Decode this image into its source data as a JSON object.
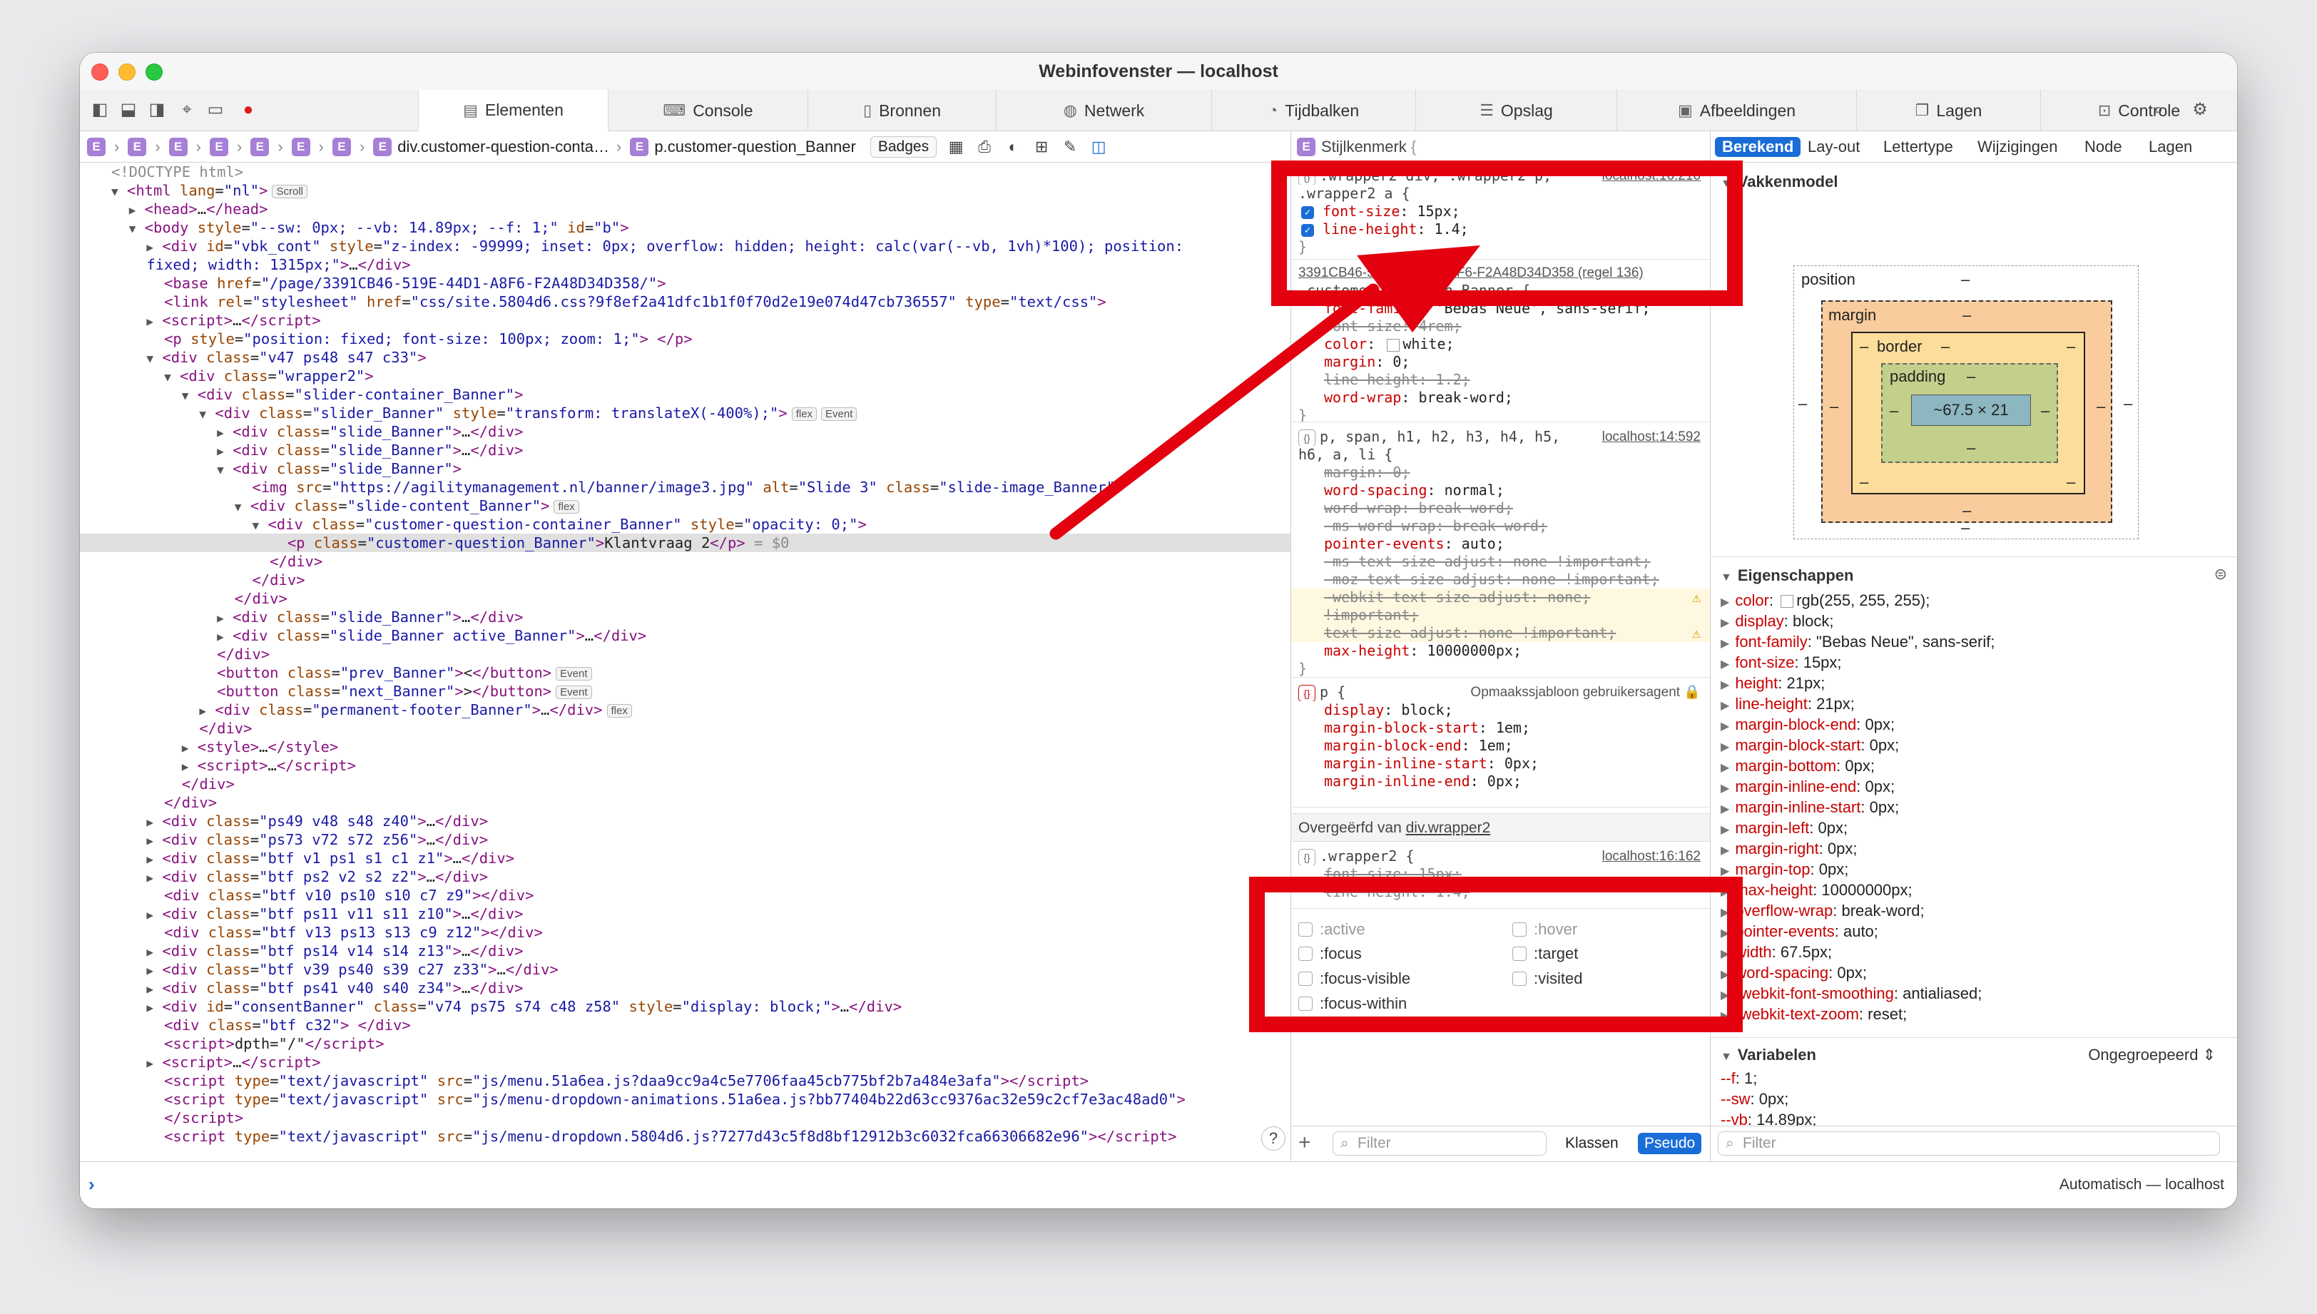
{
  "window": {
    "title": "Webinfovenster — localhost"
  },
  "tabs": [
    {
      "label": "Elementen",
      "icon": "elements-icon",
      "glyph": "▤"
    },
    {
      "label": "Console",
      "icon": "console-icon",
      "glyph": "⌨"
    },
    {
      "label": "Bronnen",
      "icon": "sources-icon",
      "glyph": "▯"
    },
    {
      "label": "Netwerk",
      "icon": "network-icon",
      "glyph": "◍"
    },
    {
      "label": "Tijdbalken",
      "icon": "timelines-icon",
      "glyph": "◔"
    },
    {
      "label": "Opslag",
      "icon": "storage-icon",
      "glyph": "☰"
    },
    {
      "label": "Afbeeldingen",
      "icon": "images-icon",
      "glyph": "▣"
    },
    {
      "label": "Lagen",
      "icon": "layers-icon",
      "glyph": "❐"
    },
    {
      "label": "Controle",
      "icon": "audit-icon",
      "glyph": "⊡"
    }
  ],
  "breadcrumb": {
    "generic_badge": "E",
    "item1": "div.customer-question-conta…",
    "item2": "p.customer-question_Banner",
    "badges_button": "Badges"
  },
  "dom": {
    "lines": [
      "&lt;!DOCTYPE html&gt;",
      "<span class='tri'>▼</span> <span class='tag'>&lt;html</span> <span class='an'>lang</span>=<span class='av'>\"nl\"</span><span class='tag'>&gt;</span><span class='pill'>Scroll</span>",
      "  <span class='tri'>▶</span> <span class='tag'>&lt;head&gt;</span>…<span class='tag'>&lt;/head&gt;</span>",
      "  <span class='tri'>▼</span> <span class='tag'>&lt;body</span> <span class='an'>style</span>=<span class='av'>\"--sw: 0px; --vb: 14.89px; --f: 1;\"</span> <span class='an'>id</span>=<span class='av'>\"b\"</span><span class='tag'>&gt;</span>",
      "    <span class='tri'>▶</span> <span class='tag'>&lt;div</span> <span class='an'>id</span>=<span class='av'>\"vbk_cont\"</span> <span class='an'>style</span>=<span class='av'>\"z-index: -99999; inset: 0px; overflow: hidden; height: calc(var(--vb, 1vh)*100); position:</span>",
      "    <span class='av'>fixed; width: 1315px;\"</span><span class='tag'>&gt;</span>…<span class='tag'>&lt;/div&gt;</span>",
      "      <span class='tag'>&lt;base</span> <span class='an'>href</span>=<span class='av'>\"/page/3391CB46-519E-44D1-A8F6-F2A48D34D358/\"</span><span class='tag'>&gt;</span>",
      "      <span class='tag'>&lt;link</span> <span class='an'>rel</span>=<span class='av'>\"stylesheet\"</span> <span class='an'>href</span>=<span class='av'>\"css/site.5804d6.css?9f8ef2a41dfc1b1f0f70d2e19e074d47cb736557\"</span> <span class='an'>type</span>=<span class='av'>\"text/css\"</span><span class='tag'>&gt;</span>",
      "    <span class='tri'>▶</span> <span class='tag'>&lt;script&gt;</span>…<span class='tag'>&lt;/script&gt;</span>",
      "      <span class='tag'>&lt;p</span> <span class='an'>style</span>=<span class='av'>\"position: fixed; font-size: 100px; zoom: 1;\"</span><span class='tag'>&gt;</span> <span class='tag'>&lt;/p&gt;</span>",
      "    <span class='tri'>▼</span> <span class='tag'>&lt;div</span> <span class='an'>class</span>=<span class='av'>\"v47 ps48 s47 c33\"</span><span class='tag'>&gt;</span>",
      "      <span class='tri'>▼</span> <span class='tag'>&lt;div</span> <span class='an'>class</span>=<span class='av'>\"wrapper2\"</span><span class='tag'>&gt;</span>",
      "        <span class='tri'>▼</span> <span class='tag'>&lt;div</span> <span class='an'>class</span>=<span class='av'>\"slider-container_Banner\"</span><span class='tag'>&gt;</span>",
      "          <span class='tri'>▼</span> <span class='tag'>&lt;div</span> <span class='an'>class</span>=<span class='av'>\"slider_Banner\"</span> <span class='an'>style</span>=<span class='av'>\"transform: translateX(-400%);\"</span><span class='tag'>&gt;</span><span class='pill'>flex</span><span class='pill'>Event</span>",
      "            <span class='tri'>▶</span> <span class='tag'>&lt;div</span> <span class='an'>class</span>=<span class='av'>\"slide_Banner\"</span><span class='tag'>&gt;</span>…<span class='tag'>&lt;/div&gt;</span>",
      "            <span class='tri'>▶</span> <span class='tag'>&lt;div</span> <span class='an'>class</span>=<span class='av'>\"slide_Banner\"</span><span class='tag'>&gt;</span>…<span class='tag'>&lt;/div&gt;</span>",
      "            <span class='tri'>▼</span> <span class='tag'>&lt;div</span> <span class='an'>class</span>=<span class='av'>\"slide_Banner\"</span><span class='tag'>&gt;</span>",
      "                <span class='tag'>&lt;img</span> <span class='an'>src</span>=<span class='av'>\"https://agilitymanagement.nl/banner/image3.jpg\"</span> <span class='an'>alt</span>=<span class='av'>\"Slide 3\"</span> <span class='an'>class</span>=<span class='av'>\"slide-image_Banner\"</span><span class='tag'>&gt;</span>",
      "              <span class='tri'>▼</span> <span class='tag'>&lt;div</span> <span class='an'>class</span>=<span class='av'>\"slide-content_Banner\"</span><span class='tag'>&gt;</span><span class='pill'>flex</span>",
      "                <span class='tri'>▼</span> <span class='tag'>&lt;div</span> <span class='an'>class</span>=<span class='av'>\"customer-question-container_Banner\"</span> <span class='an'>style</span>=<span class='av'>\"opacity: 0;\"</span><span class='tag'>&gt;</span>",
      "                    <span class='tag'>&lt;p</span> <span class='an'>class</span>=<span class='av'>\"customer-question_Banner\"</span><span class='tag'>&gt;</span><span class='tx'>Klantvraag 2</span><span class='tag'>&lt;/p&gt;</span> <span class='cm'>= $0</span>",
      "                  <span class='tag'>&lt;/div&gt;</span>",
      "                <span class='tag'>&lt;/div&gt;</span>",
      "              <span class='tag'>&lt;/div&gt;</span>",
      "            <span class='tri'>▶</span> <span class='tag'>&lt;div</span> <span class='an'>class</span>=<span class='av'>\"slide_Banner\"</span><span class='tag'>&gt;</span>…<span class='tag'>&lt;/div&gt;</span>",
      "            <span class='tri'>▶</span> <span class='tag'>&lt;div</span> <span class='an'>class</span>=<span class='av'>\"slide_Banner active_Banner\"</span><span class='tag'>&gt;</span>…<span class='tag'>&lt;/div&gt;</span>",
      "            <span class='tag'>&lt;/div&gt;</span>",
      "            <span class='tag'>&lt;button</span> <span class='an'>class</span>=<span class='av'>\"prev_Banner\"</span><span class='tag'>&gt;</span>&lt;<span class='tag'>&lt;/button&gt;</span><span class='pill'>Event</span>",
      "            <span class='tag'>&lt;button</span> <span class='an'>class</span>=<span class='av'>\"next_Banner\"</span><span class='tag'>&gt;</span>&gt;<span class='tag'>&lt;/button&gt;</span><span class='pill'>Event</span>",
      "          <span class='tri'>▶</span> <span class='tag'>&lt;div</span> <span class='an'>class</span>=<span class='av'>\"permanent-footer_Banner\"</span><span class='tag'>&gt;</span>…<span class='tag'>&lt;/div&gt;</span><span class='pill'>flex</span>",
      "          <span class='tag'>&lt;/div&gt;</span>",
      "        <span class='tri'>▶</span> <span class='tag'>&lt;style&gt;</span>…<span class='tag'>&lt;/style&gt;</span>",
      "        <span class='tri'>▶</span> <span class='tag'>&lt;script&gt;</span>…<span class='tag'>&lt;/script&gt;</span>",
      "        <span class='tag'>&lt;/div&gt;</span>",
      "      <span class='tag'>&lt;/div&gt;</span>",
      "    <span class='tri'>▶</span> <span class='tag'>&lt;div</span> <span class='an'>class</span>=<span class='av'>\"ps49 v48 s48 z40\"</span><span class='tag'>&gt;</span>…<span class='tag'>&lt;/div&gt;</span>",
      "    <span class='tri'>▶</span> <span class='tag'>&lt;div</span> <span class='an'>class</span>=<span class='av'>\"ps73 v72 s72 z56\"</span><span class='tag'>&gt;</span>…<span class='tag'>&lt;/div&gt;</span>",
      "    <span class='tri'>▶</span> <span class='tag'>&lt;div</span> <span class='an'>class</span>=<span class='av'>\"btf v1 ps1 s1 c1 z1\"</span><span class='tag'>&gt;</span>…<span class='tag'>&lt;/div&gt;</span>",
      "    <span class='tri'>▶</span> <span class='tag'>&lt;div</span> <span class='an'>class</span>=<span class='av'>\"btf ps2 v2 s2 z2\"</span><span class='tag'>&gt;</span>…<span class='tag'>&lt;/div&gt;</span>",
      "      <span class='tag'>&lt;div</span> <span class='an'>class</span>=<span class='av'>\"btf v10 ps10 s10 c7 z9\"</span><span class='tag'>&gt;&lt;/div&gt;</span>",
      "    <span class='tri'>▶</span> <span class='tag'>&lt;div</span> <span class='an'>class</span>=<span class='av'>\"btf ps11 v11 s11 z10\"</span><span class='tag'>&gt;</span>…<span class='tag'>&lt;/div&gt;</span>",
      "      <span class='tag'>&lt;div</span> <span class='an'>class</span>=<span class='av'>\"btf v13 ps13 s13 c9 z12\"</span><span class='tag'>&gt;&lt;/div&gt;</span>",
      "    <span class='tri'>▶</span> <span class='tag'>&lt;div</span> <span class='an'>class</span>=<span class='av'>\"btf ps14 v14 s14 z13\"</span><span class='tag'>&gt;</span>…<span class='tag'>&lt;/div&gt;</span>",
      "    <span class='tri'>▶</span> <span class='tag'>&lt;div</span> <span class='an'>class</span>=<span class='av'>\"btf v39 ps40 s39 c27 z33\"</span><span class='tag'>&gt;</span>…<span class='tag'>&lt;/div&gt;</span>",
      "    <span class='tri'>▶</span> <span class='tag'>&lt;div</span> <span class='an'>class</span>=<span class='av'>\"btf ps41 v40 s40 z34\"</span><span class='tag'>&gt;</span>…<span class='tag'>&lt;/div&gt;</span>",
      "    <span class='tri'>▶</span> <span class='tag'>&lt;div</span> <span class='an'>id</span>=<span class='av'>\"consentBanner\"</span> <span class='an'>class</span>=<span class='av'>\"v74 ps75 s74 c48 z58\"</span> <span class='an'>style</span>=<span class='av'>\"display: block;\"</span><span class='tag'>&gt;</span>…<span class='tag'>&lt;/div&gt;</span>",
      "      <span class='tag'>&lt;div</span> <span class='an'>class</span>=<span class='av'>\"btf c32\"</span><span class='tag'>&gt;</span> <span class='tag'>&lt;/div&gt;</span>",
      "      <span class='tag'>&lt;script&gt;</span><span class='tx'>dpth=\"/\"</span><span class='tag'>&lt;/script&gt;</span>",
      "    <span class='tri'>▶</span> <span class='tag'>&lt;script&gt;</span>…<span class='tag'>&lt;/script&gt;</span>",
      "      <span class='tag'>&lt;script</span> <span class='an'>type</span>=<span class='av'>\"text/javascript\"</span> <span class='an'>src</span>=<span class='av'>\"js/menu.51a6ea.js?daa9cc9a4c5e7706faa45cb775bf2b7a484e3afa\"</span><span class='tag'>&gt;&lt;/script&gt;</span>",
      "      <span class='tag'>&lt;script</span> <span class='an'>type</span>=<span class='av'>\"text/javascript\"</span> <span class='an'>src</span>=<span class='av'>\"js/menu-dropdown-animations.51a6ea.js?bb77404b22d63cc9376ac32e59c2cf7e3ac48ad0\"</span><span class='tag'>&gt;</span>",
      "      <span class='tag'>&lt;/script&gt;</span>",
      "      <span class='tag'>&lt;script</span> <span class='an'>type</span>=<span class='av'>\"text/javascript\"</span> <span class='an'>src</span>=<span class='av'>\"js/menu-dropdown.5804d6.js?7277d43c5f8d8bf12912b3c6032fca66306682e96\"</span><span class='tag'>&gt;&lt;/script&gt;</span>"
    ]
  },
  "styles": {
    "header": "Stijlkenmerk",
    "rule1": {
      "selector1": ".wrapper2 div, .wrapper2 p,",
      "selector2": ".wrapper2 a {",
      "source": "localhost:16:216",
      "prop1_name": "font-size",
      "prop1_value": "15px",
      "prop2_name": "line-height",
      "prop2_value": "1.4"
    },
    "rule2": {
      "source": "3391CB46-519E-44D1-A8F6-F2A48D34D358 (regel 136)",
      "selector": ".customer-question_Banner {",
      "props": [
        {
          "n": "font-family",
          "v": "'Bebas Neue', sans-serif",
          "s": false
        },
        {
          "n": "font-size",
          "v": "4rem",
          "s": true
        },
        {
          "n": "color",
          "v": "white",
          "s": false,
          "swatch": true
        },
        {
          "n": "margin",
          "v": "0",
          "s": false
        },
        {
          "n": "line-height",
          "v": "1.2",
          "s": true
        },
        {
          "n": "word-wrap",
          "v": "break-word",
          "s": false
        }
      ]
    },
    "rule3": {
      "selector1": "p, span, h1, h2, h3, h4, h5,",
      "selector2": "h6, a, li {",
      "source": "localhost:14:592",
      "props": [
        {
          "n": "margin",
          "v": "0",
          "s": true
        },
        {
          "n": "word-spacing",
          "v": "normal",
          "s": false
        },
        {
          "n": "word-wrap",
          "v": "break-word",
          "s": true
        },
        {
          "n": "-ms-word-wrap",
          "v": "break-word",
          "s": true
        },
        {
          "n": "pointer-events",
          "v": "auto",
          "s": false
        },
        {
          "n": "-ms-text-size-adjust",
          "v": "none !important",
          "s": true
        },
        {
          "n": "-moz-text-size-adjust",
          "v": "none !important",
          "s": true
        },
        {
          "n": "-webkit-text-size-adjust",
          "v": "none",
          "s": true,
          "warn": true
        },
        {
          "n": "",
          "v": "!important",
          "s": true,
          "cont": true
        },
        {
          "n": "text-size-adjust",
          "v": "none !important",
          "s": true,
          "warn": true
        },
        {
          "n": "max-height",
          "v": "10000000px",
          "s": false
        }
      ]
    },
    "rule4": {
      "selector": "p {",
      "source": "Opmaakssjabloon gebruikersagent",
      "props": [
        {
          "n": "display",
          "v": "block"
        },
        {
          "n": "margin-block-start",
          "v": "1em"
        },
        {
          "n": "margin-block-end",
          "v": "1em"
        },
        {
          "n": "margin-inline-start",
          "v": "0px"
        },
        {
          "n": "margin-inline-end",
          "v": "0px"
        }
      ]
    },
    "inherited_label": "Overgeërfd van",
    "inherited_from": "div.wrapper2",
    "rule5": {
      "selector": ".wrapper2 {",
      "source": "localhost:16:162",
      "prop1_name": "font-size",
      "prop1_value": "15px",
      "prop2_name": "line-height",
      "prop2_value": "1.4"
    },
    "pseudo": {
      "active": ":active",
      "hover": ":hover",
      "focus": ":focus",
      "target": ":target",
      "focus_visible": ":focus-visible",
      "visited": ":visited",
      "focus_within": ":focus-within"
    },
    "footer": {
      "filter": "Filter",
      "classes": "Klassen",
      "pseudo": "Pseudo"
    }
  },
  "computed": {
    "tabs": [
      "Berekend",
      "Lay-out",
      "Lettertype",
      "Wijzigingen",
      "Node",
      "Lagen"
    ],
    "boxmodel_title": "Vakkenmodel",
    "boxmodel": {
      "position": "position",
      "margin": "margin",
      "border": "border",
      "padding": "padding",
      "content": "~67.5 × 21",
      "dash": "–"
    },
    "props_title": "Eigenschappen",
    "props": [
      {
        "n": "color",
        "v": "rgb(255, 255, 255)",
        "swatch": true
      },
      {
        "n": "display",
        "v": "block"
      },
      {
        "n": "font-family",
        "v": "\"Bebas Neue\", sans-serif"
      },
      {
        "n": "font-size",
        "v": "15px"
      },
      {
        "n": "height",
        "v": "21px"
      },
      {
        "n": "line-height",
        "v": "21px"
      },
      {
        "n": "margin-block-end",
        "v": "0px"
      },
      {
        "n": "margin-block-start",
        "v": "0px"
      },
      {
        "n": "margin-bottom",
        "v": "0px"
      },
      {
        "n": "margin-inline-end",
        "v": "0px"
      },
      {
        "n": "margin-inline-start",
        "v": "0px"
      },
      {
        "n": "margin-left",
        "v": "0px"
      },
      {
        "n": "margin-right",
        "v": "0px"
      },
      {
        "n": "margin-top",
        "v": "0px"
      },
      {
        "n": "max-height",
        "v": "10000000px"
      },
      {
        "n": "overflow-wrap",
        "v": "break-word"
      },
      {
        "n": "pointer-events",
        "v": "auto"
      },
      {
        "n": "width",
        "v": "67.5px"
      },
      {
        "n": "word-spacing",
        "v": "0px"
      },
      {
        "n": "-webkit-font-smoothing",
        "v": "antialiased"
      },
      {
        "n": "-webkit-text-zoom",
        "v": "reset"
      }
    ],
    "vars_title": "Variabelen",
    "grouping": "Ongegroepeerd",
    "vars": [
      {
        "n": "--f",
        "v": "1"
      },
      {
        "n": "--sw",
        "v": "0px"
      },
      {
        "n": "--vb",
        "v": "14.89px"
      }
    ],
    "filter": "Filter"
  },
  "console": {
    "status": "Automatisch — localhost"
  },
  "colors": {
    "accent": "#1a6dd6",
    "annotation_red": "#e3000f"
  }
}
